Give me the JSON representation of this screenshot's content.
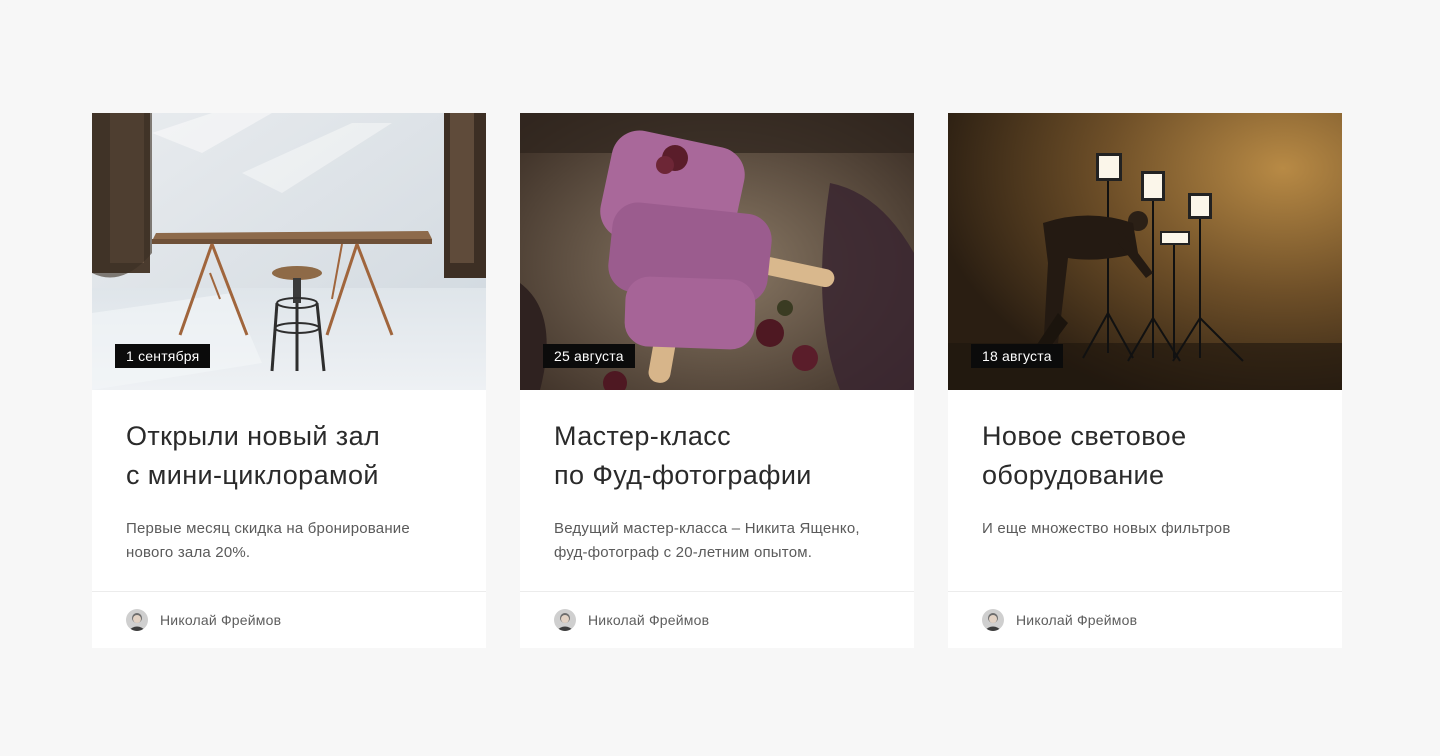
{
  "cards": [
    {
      "date": "1 сентября",
      "title": "Открыли новый зал\nс мини-циклорамой",
      "description": "Первые месяц скидка на бронирование\nнового зала 20%.",
      "author": "Николай Фреймов",
      "image": "photo-studio-table-stool"
    },
    {
      "date": "25 августа",
      "title": "Мастер-класс\nпо Фуд-фотографии",
      "description": "Ведущий мастер-класса – Никита Ященко,\nфуд-фотограф с 20-летним опытом.",
      "author": "Николай Фреймов",
      "image": "photo-berry-popsicles"
    },
    {
      "date": "18 августа",
      "title": "Новое световое\nоборудование",
      "description": "И еще множество новых фильтров",
      "author": "Николай Фреймов",
      "image": "photo-lighting-equipment"
    }
  ],
  "colors": {
    "page_background": "#f7f7f7",
    "card_background": "#ffffff",
    "badge_background": "#0b0b0b",
    "badge_text": "#ffffff",
    "title_text": "#2a2a2a",
    "description_text": "#5a5a5a"
  }
}
